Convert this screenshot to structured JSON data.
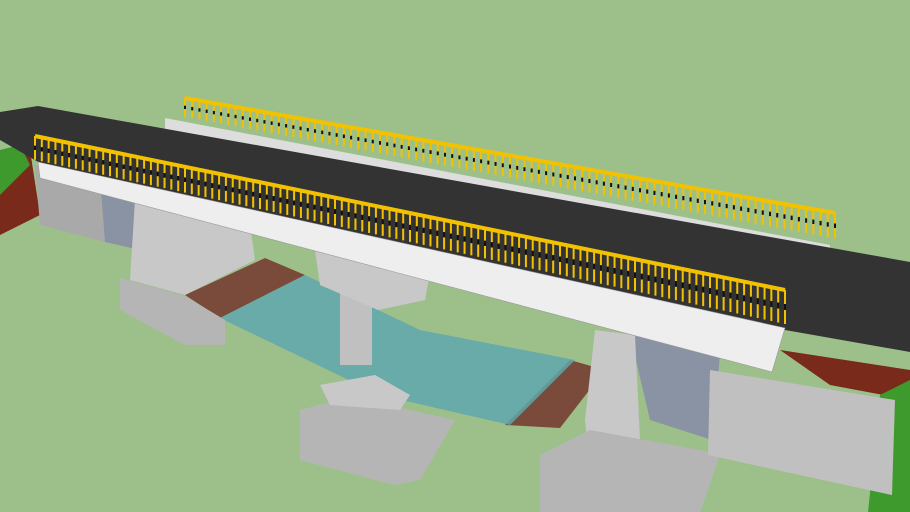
{
  "scene": {
    "subject": "bridge-3d-model",
    "colors": {
      "background": "#9dc08b",
      "asphalt": "#333333",
      "concrete": "#c8c8c8",
      "concrete_dark": "#a9a9a9",
      "deck_face": "#eeeeee",
      "railing_yellow": "#f2c200",
      "railing_black": "#111111",
      "water": "#5fa7ad",
      "riverbed": "#7a4a3a",
      "embankment": "#7a2a1a",
      "stone": "#8a93a3",
      "grass": "#3f9a2e"
    }
  }
}
